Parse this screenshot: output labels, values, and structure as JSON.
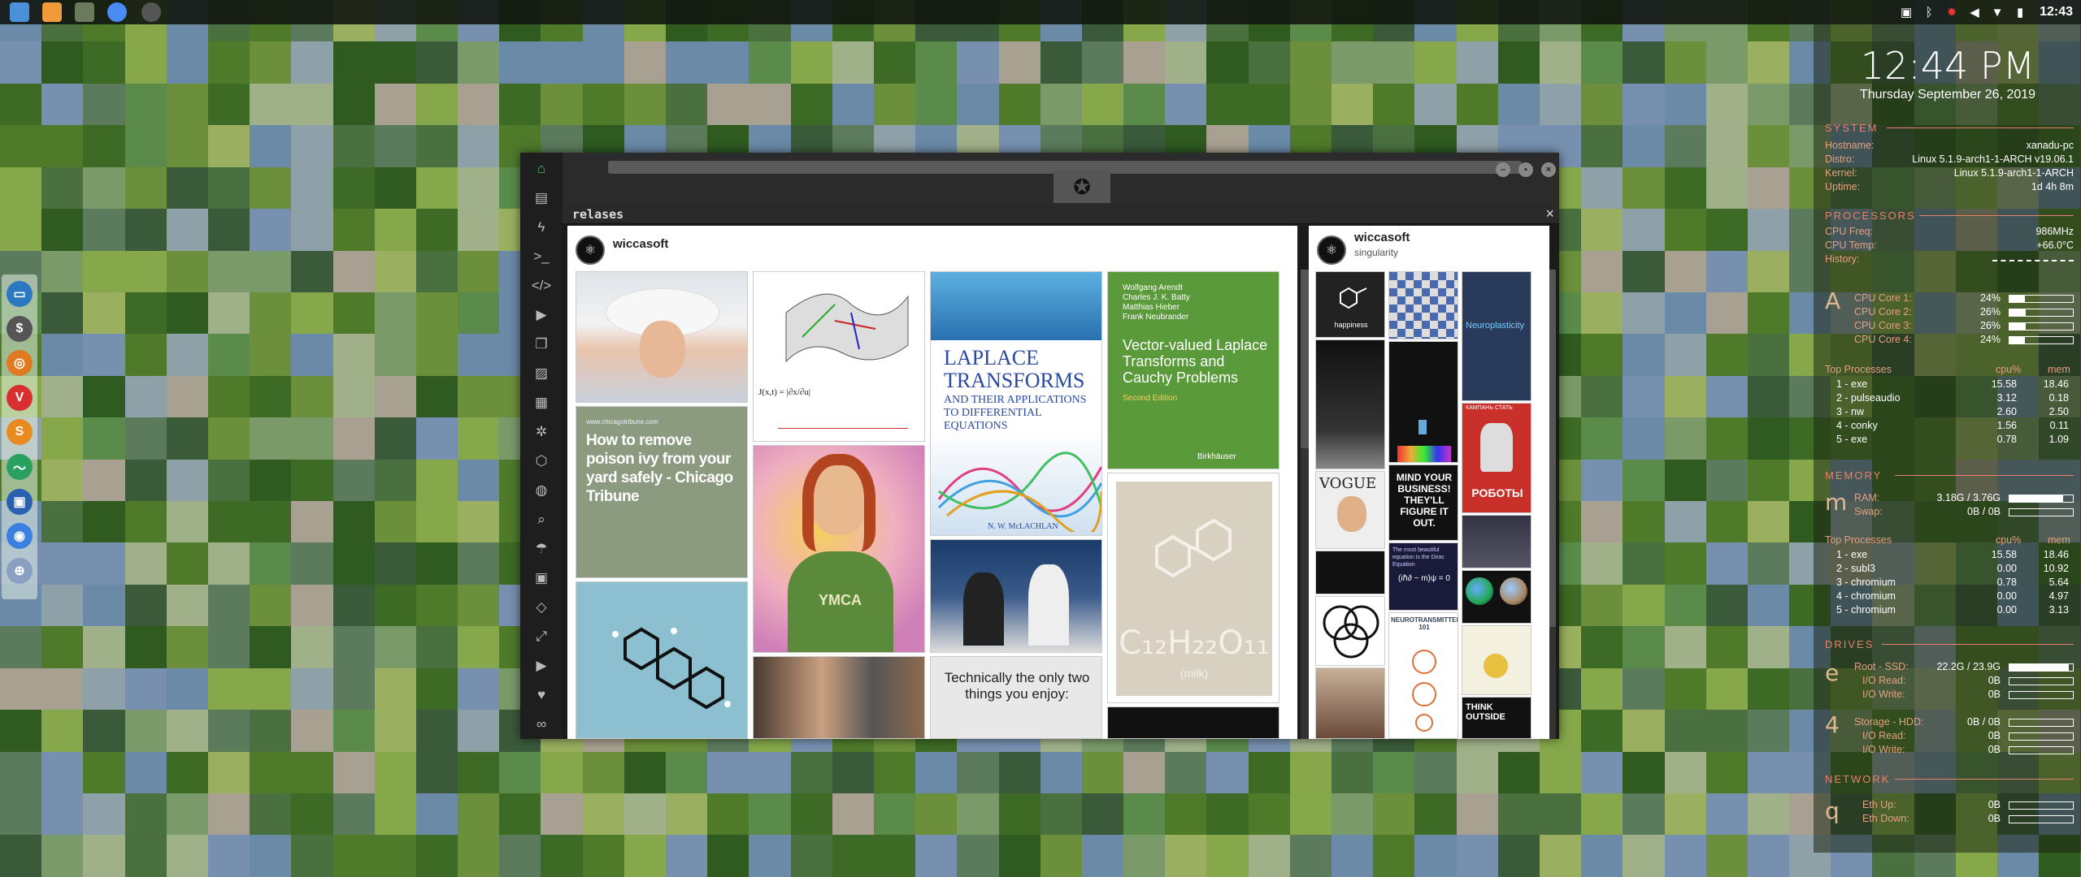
{
  "colors": {
    "accent": "#e8806a",
    "conky_label": "#e2a080",
    "wallpaper_base": "#4f7a2a"
  },
  "topbar": {
    "apps": [
      {
        "icon": "folder-icon",
        "color": "#4a90d9"
      },
      {
        "icon": "sublime-icon",
        "color": "#f09a3b"
      },
      {
        "icon": "gimp-icon",
        "color": "#6a7a5a"
      },
      {
        "icon": "chromium-icon",
        "color": "#4a8af4"
      },
      {
        "icon": "steam-icon",
        "color": "#555555"
      }
    ],
    "tray": {
      "clock": "12:43"
    }
  },
  "dock": {
    "items": [
      {
        "icon": "files-icon",
        "color": "#2a78c0",
        "glyph": "▭"
      },
      {
        "icon": "money-icon",
        "color": "#555555",
        "glyph": "$"
      },
      {
        "icon": "firefox-icon",
        "color": "#e07a20",
        "glyph": "◎"
      },
      {
        "icon": "vivaldi-icon",
        "color": "#d83030",
        "glyph": "V"
      },
      {
        "icon": "sublime-icon",
        "color": "#e88a20",
        "glyph": "S"
      },
      {
        "icon": "monitor-icon",
        "color": "#2aa060",
        "glyph": "〜"
      },
      {
        "icon": "screenshot-icon",
        "color": "#2a60b0",
        "glyph": "▣"
      },
      {
        "icon": "chrome-icon",
        "color": "#3a80e0",
        "glyph": "◉"
      },
      {
        "icon": "globe-icon",
        "color": "#8aa0c0",
        "glyph": "⊕"
      }
    ]
  },
  "conky": {
    "time": "12:44 PM",
    "date": "Thursday September 26, 2019",
    "system": {
      "title": "SYSTEM",
      "rows": [
        {
          "k": "Hostname:",
          "v": "xanadu-pc"
        },
        {
          "k": "Distro:",
          "v": "Linux 5.1.9-arch1-1-ARCH v19.06.1"
        },
        {
          "k": "Kernel:",
          "v": "Linux 5.1.9-arch1-1-ARCH"
        },
        {
          "k": "Uptime:",
          "v": "1d 4h 8m"
        }
      ]
    },
    "processors": {
      "title": "PROCESSORS",
      "freq_k": "CPU Freq:",
      "freq_v": "986MHz",
      "temp_k": "CPU Temp:",
      "temp_v": "+66.0°C",
      "hist_k": "History:",
      "letter": "A",
      "cores": [
        {
          "k": "CPU Core 1:",
          "v": "24%",
          "p": 0.24
        },
        {
          "k": "CPU Core 2:",
          "v": "26%",
          "p": 0.26
        },
        {
          "k": "CPU Core 3:",
          "v": "26%",
          "p": 0.26
        },
        {
          "k": "CPU Core 4:",
          "v": "24%",
          "p": 0.24
        }
      ],
      "top_title": "Top Processes",
      "cpu_h": "cpu%",
      "mem_h": "mem",
      "top": [
        {
          "n": "1 - exe",
          "c": "15.58",
          "m": "18.46"
        },
        {
          "n": "2 - pulseaudio",
          "c": "3.12",
          "m": "0.18"
        },
        {
          "n": "3 - nw",
          "c": "2.60",
          "m": "2.50"
        },
        {
          "n": "4 - conky",
          "c": "1.56",
          "m": "0.11"
        },
        {
          "n": "5 - exe",
          "c": "0.78",
          "m": "1.09"
        }
      ]
    },
    "memory": {
      "title": "MEMORY",
      "letter": "m",
      "ram_k": "RAM:",
      "ram_v": "3.18G / 3.76G",
      "ram_p": 0.85,
      "swap_k": "Swap:",
      "swap_v": "0B / 0B",
      "top_title": "Top Processes",
      "cpu_h": "cpu%",
      "mem_h": "mem",
      "top": [
        {
          "n": "1 - exe",
          "c": "15.58",
          "m": "18.46"
        },
        {
          "n": "2 - subl3",
          "c": "0.00",
          "m": "10.92"
        },
        {
          "n": "3 - chromium",
          "c": "0.78",
          "m": "5.64"
        },
        {
          "n": "4 - chromium",
          "c": "0.00",
          "m": "4.97"
        },
        {
          "n": "5 - chromium",
          "c": "0.00",
          "m": "3.13"
        }
      ]
    },
    "drives": {
      "title": "DRIVES",
      "root": {
        "letter": "e",
        "k": "Root - SSD:",
        "v": "22.2G / 23.9G",
        "p": 0.93,
        "rk": "I/O Read:",
        "rv": "0B",
        "wk": "I/O Write:",
        "wv": "0B"
      },
      "storage": {
        "letter": "4",
        "k": "Storage - HDD:",
        "v": "0B / 0B",
        "p": 0,
        "rk": "I/O Read:",
        "rv": "0B",
        "wk": "I/O Write:",
        "wv": "0B"
      }
    },
    "network": {
      "title": "NETWORK",
      "letter": "q",
      "up_k": "Eth Up:",
      "up_v": "0B",
      "down_k": "Eth Down:",
      "down_v": "0B"
    }
  },
  "window": {
    "sidebar_icons": [
      "home-icon",
      "document-icon",
      "bolt-icon",
      "terminal-icon",
      "code-icon",
      "play-icon",
      "copy-icon",
      "image-icon",
      "newspaper-icon",
      "settings-icon",
      "hexagon-icon",
      "globe-icon",
      "search-icon",
      "umbrella-icon",
      "contact-icon",
      "share-icon",
      "expand-icon",
      "youtube-icon",
      "heart-icon",
      "cloud-icon"
    ],
    "sidebar_glyphs": [
      "⌂",
      "▤",
      "ϟ",
      ">_",
      "</>",
      "▶",
      "❐",
      "▨",
      "▦",
      "✲",
      "⬡",
      "◍",
      "⌕",
      "☂",
      "▣",
      "◇",
      "⤢",
      "▶",
      "♥",
      "∞"
    ],
    "tab": {
      "name": "relases",
      "close": "×"
    },
    "logo": "✪",
    "left_panel": {
      "user": "wiccasoft",
      "pins": {
        "poison_source": "www.chicagotribune.com",
        "poison_title": "How to remove poison ivy from your yard safely - Chicago Tribune",
        "laplace_title": "LAPLACE TRANSFORMS",
        "laplace_sub": "AND THEIR APPLICATIONS TO DIFFERENTIAL EQUATIONS",
        "laplace_author": "N. W. McLACHLAN",
        "vector_authors": "Wolfgang Arendt\nCharles J. K. Batty\nMatthias Hieber\nFrank Neubrander",
        "vector_title": "Vector-valued Laplace Transforms and Cauchy Problems",
        "vector_edition": "Second Edition",
        "vector_pub": "Birkhäuser",
        "milk_formula": "C₁₂H₂₂O₁₁",
        "milk_word": "(milk)",
        "shirt_text": "YMCA",
        "tech_text": "Technically the only two things you enjoy:",
        "jacobian": "J(x,t) = |∂x/∂u|"
      }
    },
    "right_panel": {
      "user": "wiccasoft",
      "sub": "singularity",
      "pins": {
        "happiness": "happiness",
        "neuro": "Neuroplasticity",
        "robots": "РОБОТЫ",
        "robots_top": "КАМПАНЬ СТАТЬ",
        "mind": "MIND YOUR BUSINESS! THEY'LL FIGURE IT OUT.",
        "neurotrans": "NEUROTRANSMITTERS 101",
        "think": "THINK OUTSIDE",
        "eq": "(iℏ∂ − m)ψ = 0",
        "eq_top": "The most beautiful equation is the Dirac Equation",
        "vogue": "VOGUE"
      }
    }
  }
}
